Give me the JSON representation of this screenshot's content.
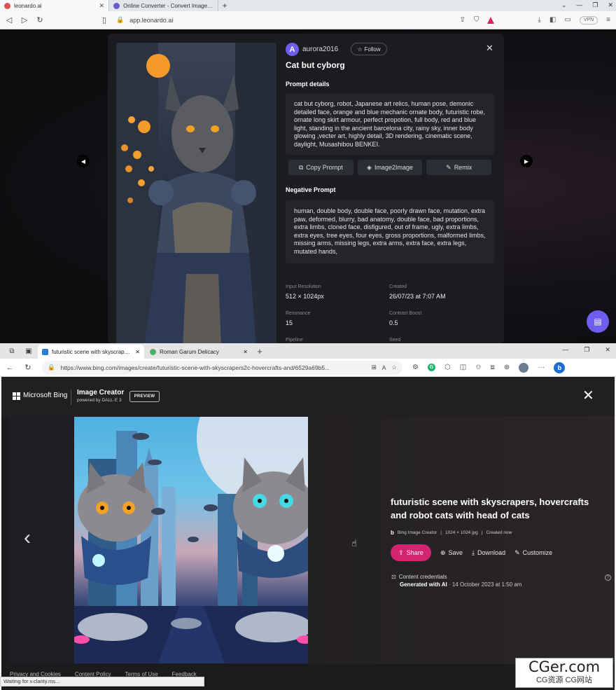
{
  "top_browser": {
    "tabs": [
      {
        "title": "leonardo.ai",
        "active": true
      },
      {
        "title": "Online Converter - Convert Image, Vid",
        "active": false
      }
    ],
    "url": "app.leonardo.ai",
    "vpn_label": "VPN"
  },
  "leonardo": {
    "username": "aurora2016",
    "avatar_letter": "A",
    "follow_label": "Follow",
    "title": "Cat but cyborg",
    "prompt_heading": "Prompt details",
    "prompt_text": "cat but cyborg, robot, Japanese art relics, human pose, demonic detailed face, orange and blue mechanic ornate body, futuristic robe, ornate long skirt armour, perfect propotion, full body, red and blue light, standing in the ancient barcelona city, rainy sky, inner body glowing ,vecter art, highly detail, 3D rendering, cinematic scene, daylight, Musashibou BENKEI.",
    "buttons": {
      "copy": "Copy Prompt",
      "image2image": "Image2Image",
      "remix": "Remix"
    },
    "negative_heading": "Negative Prompt",
    "negative_text": "human, double body, double face, poorly drawn face, mutation, extra paw, deformed, blurry, bad anatomy, double face, bad proportions, extra limbs, cloned face, disfigured, out of frame, ugly, extra limbs, extra eyes, tree eyes, four eyes, gross proportions, malformed limbs, missing arms, missing legs, extra arms, extra face, extra legs, mutated hands,",
    "meta": {
      "input_resolution_label": "Input Resolution",
      "input_resolution": "512 × 1024px",
      "created_label": "Created",
      "created": "26/07/23 at 7:07 AM",
      "resonance_label": "Resonance",
      "resonance": "15",
      "contrast_label": "Contrast Boost",
      "contrast": "0.5",
      "pipeline_label": "Pipeline",
      "seed_label": "Seed"
    }
  },
  "bottom_browser": {
    "tabs": [
      {
        "title": "futuristic scene with skyscrapers",
        "active": true
      },
      {
        "title": "Roman Garum Delicacy",
        "active": false
      }
    ],
    "url": "https://www.bing.com/images/create/futuristic-scene-with-skyscrapers2c-hovercrafts-and/6529a69b5..."
  },
  "bing": {
    "brand": "Microsoft Bing",
    "product": "Image Creator",
    "powered_by": "powered by DALL·E 3",
    "preview": "PREVIEW",
    "image_title": "futuristic scene with skyscrapers, hovercrafts and robot cats with head of cats",
    "source": "Bing Image Creator",
    "size": "1024 × 1024 jpg",
    "created": "Created now",
    "actions": {
      "share": "Share",
      "save": "Save",
      "download": "Download",
      "customize": "Customize"
    },
    "credentials_label": "Content credentials",
    "generated_label": "Generated with AI",
    "generated_date": "· 14 October 2023 at 1:50 am",
    "footer": [
      "Privacy and Cookies",
      "Content Policy",
      "Terms of Use",
      "Feedback"
    ],
    "status": "Waiting for v.clarity.ms..."
  },
  "watermark": {
    "line1": "CGer.com",
    "line2": "CG资源 CG网站"
  }
}
